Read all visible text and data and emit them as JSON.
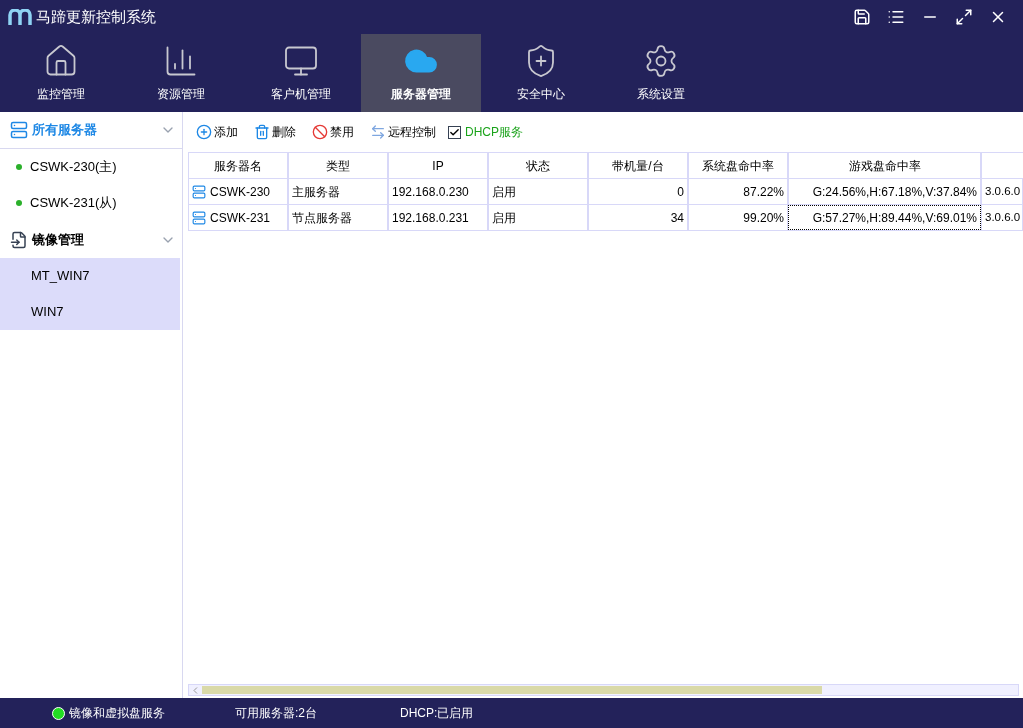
{
  "window": {
    "title": "马蹄更新控制系统"
  },
  "nav_tabs": [
    {
      "label": "监控管理",
      "kind": "monitor",
      "selected": false
    },
    {
      "label": "资源管理",
      "kind": "chart",
      "selected": false
    },
    {
      "label": "客户机管理",
      "kind": "desktop",
      "selected": false
    },
    {
      "label": "服务器管理",
      "kind": "cloud",
      "selected": true
    },
    {
      "label": "安全中心",
      "kind": "shield",
      "selected": false
    },
    {
      "label": "系统设置",
      "kind": "gear",
      "selected": false
    }
  ],
  "sidebar": {
    "groups": [
      {
        "label": "所有服务器",
        "kind": "server",
        "selected": true,
        "expanded": true,
        "items": [
          {
            "label": "CSWK-230(主)",
            "kind": "dot",
            "selected": false
          },
          {
            "label": "CSWK-231(从)",
            "kind": "dot",
            "selected": false
          }
        ]
      },
      {
        "label": "镜像管理",
        "kind": "image",
        "selected": false,
        "expanded": true,
        "items": [
          {
            "label": "MT_WIN7",
            "kind": "plain",
            "selected": true
          },
          {
            "label": "WIN7",
            "kind": "plain",
            "selected": true
          }
        ]
      }
    ]
  },
  "toolbar": [
    {
      "label": "添加",
      "kind": "add"
    },
    {
      "label": "删除",
      "kind": "delete"
    },
    {
      "label": "禁用",
      "kind": "ban"
    },
    {
      "label": "远程控制",
      "kind": "remote"
    }
  ],
  "dhcp_checkbox": {
    "label": "DHCP服务",
    "checked": true
  },
  "table": {
    "columns": [
      "服务器名",
      "类型",
      "IP",
      "状态",
      "带机量/台",
      "系统盘命中率",
      "游戏盘命中率"
    ],
    "rows": [
      {
        "cells": [
          "CSWK-230",
          "主服务器",
          "192.168.0.230",
          "启用",
          "0",
          "87.22%",
          "G:24.56%,H:67.18%,V:37.84%",
          "3.0.6.0"
        ],
        "focused_cell": false
      },
      {
        "cells": [
          "CSWK-231",
          "节点服务器",
          "192.168.0.231",
          "启用",
          "34",
          "99.20%",
          "G:57.27%,H:89.44%,V:69.01%",
          "3.0.6.0"
        ],
        "focused_cell": true
      }
    ]
  },
  "status_bar": [
    {
      "label": "镜像和虚拟盘服务",
      "kind": "led"
    },
    {
      "label": "可用服务器:2台",
      "kind": "text"
    },
    {
      "label": "DHCP:已启用",
      "kind": "text"
    }
  ]
}
